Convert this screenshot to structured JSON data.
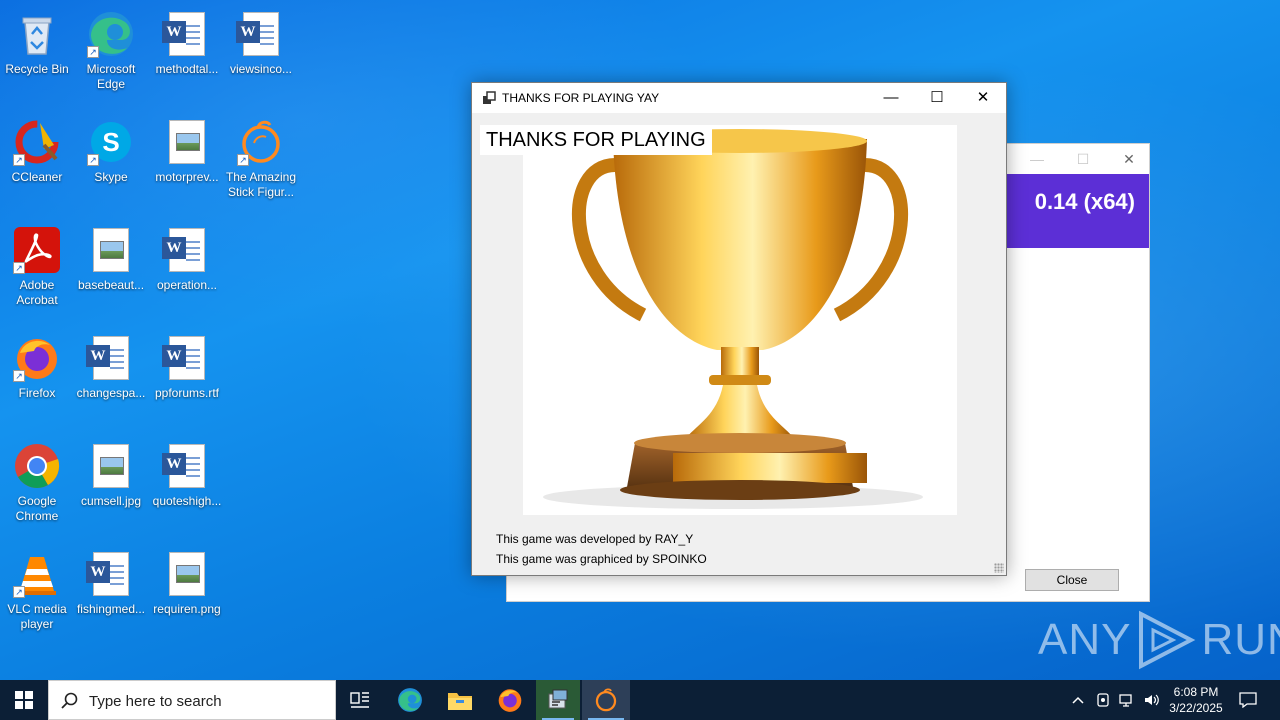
{
  "desktop": {
    "icons": [
      {
        "label": "Recycle Bin",
        "icon": "recycle-bin-icon"
      },
      {
        "label": "Microsoft Edge",
        "icon": "edge-icon"
      },
      {
        "label": "methodtal...",
        "icon": "word-document-icon"
      },
      {
        "label": "viewsinco...",
        "icon": "word-document-icon"
      },
      {
        "label": "CCleaner",
        "icon": "ccleaner-icon"
      },
      {
        "label": "Skype",
        "icon": "skype-icon"
      },
      {
        "label": "motorprev...",
        "icon": "image-file-icon"
      },
      {
        "label": "The Amazing Stick Figur...",
        "icon": "orange-app-icon"
      },
      {
        "label": "Adobe Acrobat",
        "icon": "acrobat-icon"
      },
      {
        "label": "basebeaut...",
        "icon": "image-file-icon"
      },
      {
        "label": "operation...",
        "icon": "word-document-icon"
      },
      {
        "label": "Firefox",
        "icon": "firefox-icon"
      },
      {
        "label": "changespa...",
        "icon": "word-document-icon"
      },
      {
        "label": "ppforums.rtf",
        "icon": "word-document-icon"
      },
      {
        "label": "Google Chrome",
        "icon": "chrome-icon"
      },
      {
        "label": "cumsell.jpg",
        "icon": "image-file-icon"
      },
      {
        "label": "quoteshigh...",
        "icon": "word-document-icon"
      },
      {
        "label": "VLC media player",
        "icon": "vlc-icon"
      },
      {
        "label": "fishingmed...",
        "icon": "word-document-icon"
      },
      {
        "label": "requiren.png",
        "icon": "image-file-icon"
      }
    ]
  },
  "background_window": {
    "banner_text": "0.14 (x64)",
    "minimize_glyph": "—",
    "maximize_glyph": "☐",
    "close_glyph": "✕",
    "close_button_label": "Close",
    "banner_color": "#5c2fd6"
  },
  "main_window": {
    "title": "THANKS FOR PLAYING YAY",
    "heading": "THANKS FOR PLAYING",
    "credit_developer": "This game was developed by RAY_Y",
    "credit_graphics": "This game was graphiced by SPOINKO",
    "minimize_glyph": "—",
    "maximize_glyph": "☐",
    "close_glyph": "✕",
    "picture": "gold-trophy-image"
  },
  "watermark": {
    "text_left": "ANY",
    "text_right": "RUN"
  },
  "taskbar": {
    "search_placeholder": "Type here to search",
    "time": "6:08 PM",
    "date": "3/22/2025",
    "apps": [
      "task-view-icon",
      "edge-icon",
      "file-explorer-icon",
      "firefox-icon",
      "installer-app-icon",
      "orange-app-icon"
    ]
  }
}
